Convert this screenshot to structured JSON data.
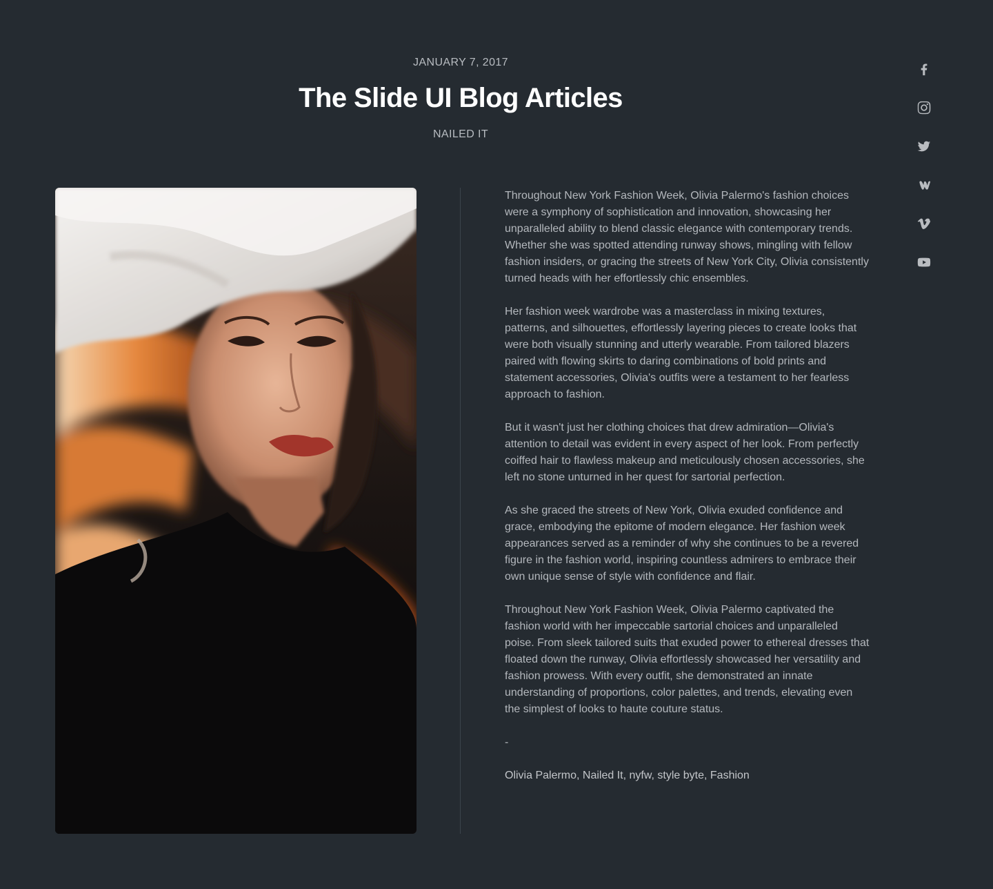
{
  "post": {
    "date": "JANUARY 7, 2017",
    "title": "The Slide UI Blog Articles",
    "category": "NAILED IT"
  },
  "social": [
    {
      "name": "facebook-icon"
    },
    {
      "name": "instagram-icon"
    },
    {
      "name": "twitter-icon"
    },
    {
      "name": "wattpad-icon"
    },
    {
      "name": "vimeo-icon"
    },
    {
      "name": "youtube-icon"
    }
  ],
  "article": {
    "paragraphs": [
      "Throughout New York Fashion Week, Olivia Palermo's fashion choices were a symphony of sophistication and innovation, showcasing her unparalleled ability to blend classic elegance with contemporary trends. Whether she was spotted attending runway shows, mingling with fellow fashion insiders, or gracing the streets of New York City, Olivia consistently turned heads with her effortlessly chic ensembles.",
      "Her fashion week wardrobe was a masterclass in mixing textures, patterns, and silhouettes, effortlessly layering pieces to create looks that were both visually stunning and utterly wearable. From tailored blazers paired with flowing skirts to daring combinations of bold prints and statement accessories, Olivia's outfits were a testament to her fearless approach to fashion.",
      "But it wasn't just her clothing choices that drew admiration—Olivia's attention to detail was evident in every aspect of her look. From perfectly coiffed hair to flawless makeup and meticulously chosen accessories, she left no stone unturned in her quest for sartorial perfection.",
      "As she graced the streets of New York, Olivia exuded confidence and grace, embodying the epitome of modern elegance. Her fashion week appearances served as a reminder of why she continues to be a revered figure in the fashion world, inspiring countless admirers to embrace their own unique sense of style with confidence and flair.",
      "Throughout New York Fashion Week, Olivia Palermo captivated the fashion world with her impeccable sartorial choices and unparalleled poise. From sleek tailored suits that exuded power to ethereal dresses that floated down the runway, Olivia effortlessly showcased her versatility and fashion prowess. With every outfit, she demonstrated an innate understanding of proportions, color palettes, and trends, elevating even the simplest of looks to haute couture status.",
      "-"
    ],
    "tags": "Olivia Palermo, Nailed It, nyfw, style byte, Fashion"
  },
  "colors": {
    "background": "#252b31",
    "title": "#ffffff",
    "body_text": "#b4b8bd",
    "divider": "#3c444c"
  }
}
